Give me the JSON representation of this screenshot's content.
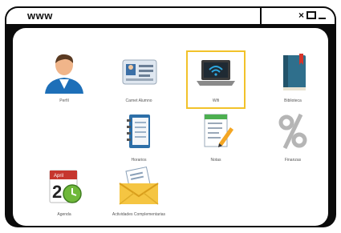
{
  "window": {
    "url": "www"
  },
  "tiles": [
    {
      "label": "Perfil",
      "icon": "user-profile-icon"
    },
    {
      "label": "Carnet Alumno",
      "icon": "id-card-icon"
    },
    {
      "label": "Wifi",
      "icon": "laptop-wifi-icon",
      "selected": true
    },
    {
      "label": "Biblioteca",
      "icon": "book-icon"
    },
    {
      "label": "Horarios",
      "icon": "notebook-icon"
    },
    {
      "label": "Notas",
      "icon": "notes-pencil-icon"
    },
    {
      "label": "Finanzas",
      "icon": "percent-icon"
    },
    {
      "label": "Agenda",
      "icon": "calendar-icon"
    },
    {
      "label": "Actividades Complementarias",
      "icon": "mail-icon"
    }
  ],
  "calendar": {
    "month": "April",
    "day": "2"
  },
  "colors": {
    "frame": "#0b0b0b",
    "highlight": "#f2c22a"
  }
}
